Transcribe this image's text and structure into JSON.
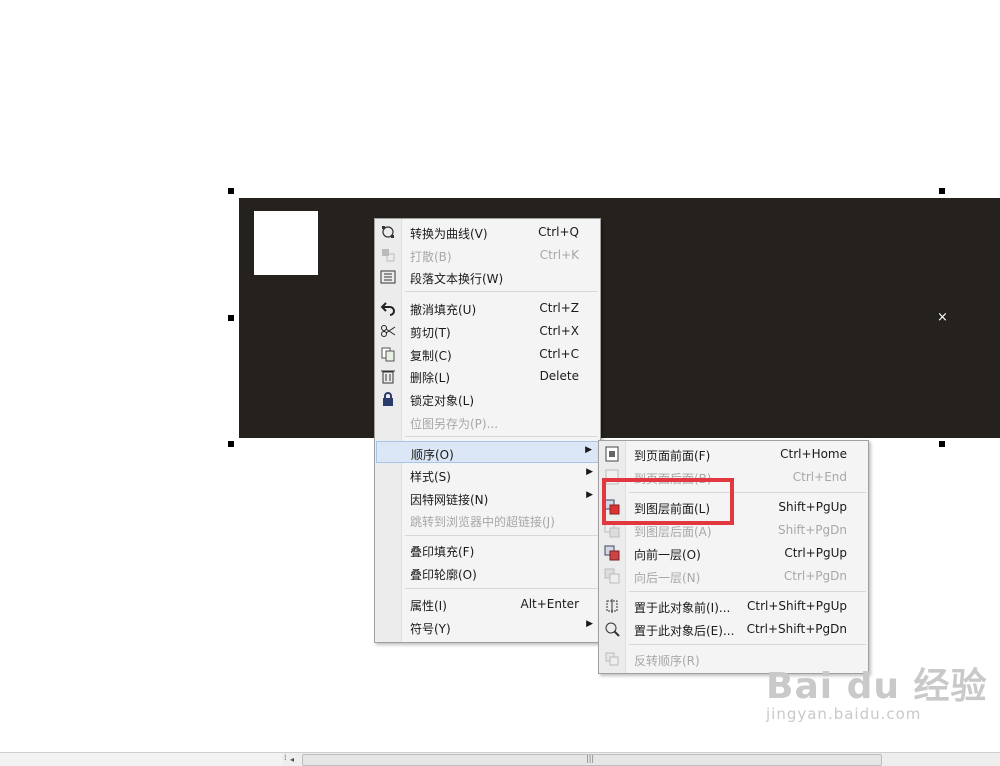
{
  "context_menu": {
    "items": [
      {
        "label": "转换为曲线(V)",
        "shortcut": "Ctrl+Q",
        "icon": "convert-to-curves-icon"
      },
      {
        "label": "打散(B)",
        "shortcut": "Ctrl+K",
        "icon": "break-apart-icon",
        "disabled": true
      },
      {
        "label": "段落文本换行(W)",
        "shortcut": "",
        "icon": "wrap-paragraph-text-icon"
      },
      {
        "label": "撤消填充(U)",
        "shortcut": "Ctrl+Z",
        "icon": "undo-icon"
      },
      {
        "label": "剪切(T)",
        "shortcut": "Ctrl+X",
        "icon": "scissors-icon"
      },
      {
        "label": "复制(C)",
        "shortcut": "Ctrl+C",
        "icon": "copy-icon"
      },
      {
        "label": "删除(L)",
        "shortcut": "Delete",
        "icon": "trash-icon"
      },
      {
        "label": "锁定对象(L)",
        "shortcut": "",
        "icon": "lock-icon"
      },
      {
        "label": "位图另存为(P)...",
        "shortcut": "",
        "disabled": true
      },
      {
        "label": "顺序(O)",
        "has_submenu": true,
        "highlighted": true
      },
      {
        "label": "样式(S)",
        "has_submenu": true
      },
      {
        "label": "因特网链接(N)",
        "has_submenu": true
      },
      {
        "label": "跳转到浏览器中的超链接(J)",
        "disabled": true
      },
      {
        "label": "叠印填充(F)"
      },
      {
        "label": "叠印轮廓(O)"
      },
      {
        "label": "属性(I)",
        "shortcut": "Alt+Enter"
      },
      {
        "label": "符号(Y)",
        "has_submenu": true
      }
    ]
  },
  "order_submenu": {
    "items": [
      {
        "label": "到页面前面(F)",
        "shortcut": "Ctrl+Home",
        "icon": "to-page-front-icon"
      },
      {
        "label": "到页面后面(B)",
        "shortcut": "Ctrl+End",
        "icon": "to-page-back-icon",
        "disabled": true
      },
      {
        "label": "到图层前面(L)",
        "shortcut": "Shift+PgUp",
        "icon": "to-layer-front-icon",
        "emphasized": true
      },
      {
        "label": "到图层后面(A)",
        "shortcut": "Shift+PgDn",
        "icon": "to-layer-back-icon",
        "disabled": true
      },
      {
        "label": "向前一层(O)",
        "shortcut": "Ctrl+PgUp",
        "icon": "forward-one-icon"
      },
      {
        "label": "向后一层(N)",
        "shortcut": "Ctrl+PgDn",
        "icon": "back-one-icon",
        "disabled": true
      },
      {
        "label": "置于此对象前(I)...",
        "shortcut": "Ctrl+Shift+PgUp",
        "icon": "in-front-of-icon"
      },
      {
        "label": "置于此对象后(E)...",
        "shortcut": "Ctrl+Shift+PgDn",
        "icon": "behind-icon"
      },
      {
        "label": "反转顺序(R)",
        "shortcut": "",
        "icon": "reverse-order-icon",
        "disabled": true
      }
    ]
  },
  "canvas": {
    "object_color": "#25211d",
    "center_marker": "×"
  },
  "highlight_box_color": "#e0383e",
  "scrollbar": {
    "left_arrow": "◂",
    "grip": "⁞",
    "thumb_grip": "|||"
  },
  "watermark": {
    "logo": "Bai du 经验",
    "url": "jingyan.baidu.com"
  }
}
